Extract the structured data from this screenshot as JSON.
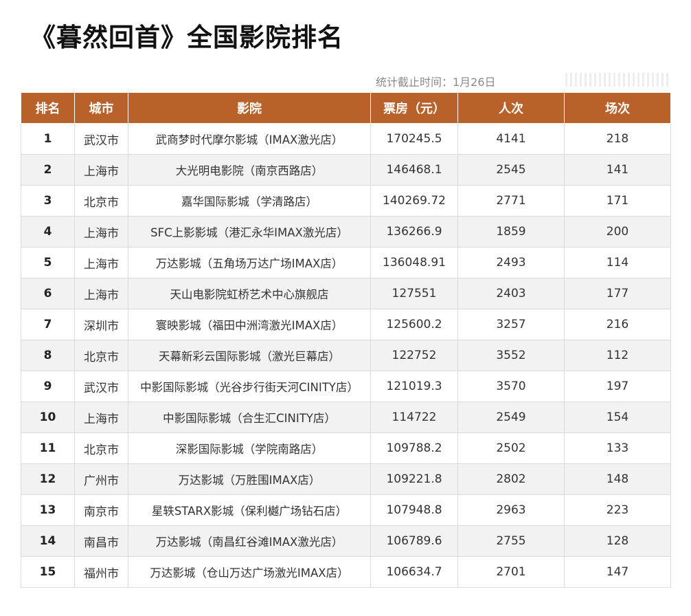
{
  "title": "《暮然回首》全国影院排名",
  "stats_date": "统计截止时间：1月26日",
  "table": {
    "headers": [
      "排名",
      "城市",
      "影院",
      "票房（元）",
      "人次",
      "场次"
    ],
    "rows": [
      [
        "1",
        "武汉市",
        "武商梦时代摩尔影城（IMAX激光店）",
        "170245.5",
        "4141",
        "218"
      ],
      [
        "2",
        "上海市",
        "大光明电影院（南京西路店）",
        "146468.1",
        "2545",
        "141"
      ],
      [
        "3",
        "北京市",
        "嘉华国际影城（学清路店）",
        "140269.72",
        "2771",
        "171"
      ],
      [
        "4",
        "上海市",
        "SFC上影影城（港汇永华IMAX激光店）",
        "136266.9",
        "1859",
        "200"
      ],
      [
        "5",
        "上海市",
        "万达影城（五角场万达广场IMAX店）",
        "136048.91",
        "2493",
        "114"
      ],
      [
        "6",
        "上海市",
        "天山电影院虹桥艺术中心旗舰店",
        "127551",
        "2403",
        "177"
      ],
      [
        "7",
        "深圳市",
        "寰映影城（福田中洲湾激光IMAX店）",
        "125600.2",
        "3257",
        "216"
      ],
      [
        "8",
        "北京市",
        "天幕新彩云国际影城（激光巨幕店）",
        "122752",
        "3552",
        "112"
      ],
      [
        "9",
        "武汉市",
        "中影国际影城（光谷步行街天河CINITY店）",
        "121019.3",
        "3570",
        "197"
      ],
      [
        "10",
        "上海市",
        "中影国际影城（合生汇CINITY店）",
        "114722",
        "2549",
        "154"
      ],
      [
        "11",
        "北京市",
        "深影国际影城（学院南路店）",
        "109788.2",
        "2502",
        "133"
      ],
      [
        "12",
        "广州市",
        "万达影城（万胜围IMAX店）",
        "109221.8",
        "2802",
        "148"
      ],
      [
        "13",
        "南京市",
        "星轶STARX影城（保利樾广场钻石店）",
        "107948.8",
        "2963",
        "223"
      ],
      [
        "14",
        "南昌市",
        "万达影城（南昌红谷滩IMAX激光店）",
        "106789.6",
        "2755",
        "128"
      ],
      [
        "15",
        "福州市",
        "万达影城（仓山万达广场激光IMAX店）",
        "106634.7",
        "2701",
        "147"
      ]
    ]
  },
  "colors": {
    "header_bg": "#b8612a",
    "header_text": "#ffffff",
    "stripe": "#f2f2f2"
  }
}
